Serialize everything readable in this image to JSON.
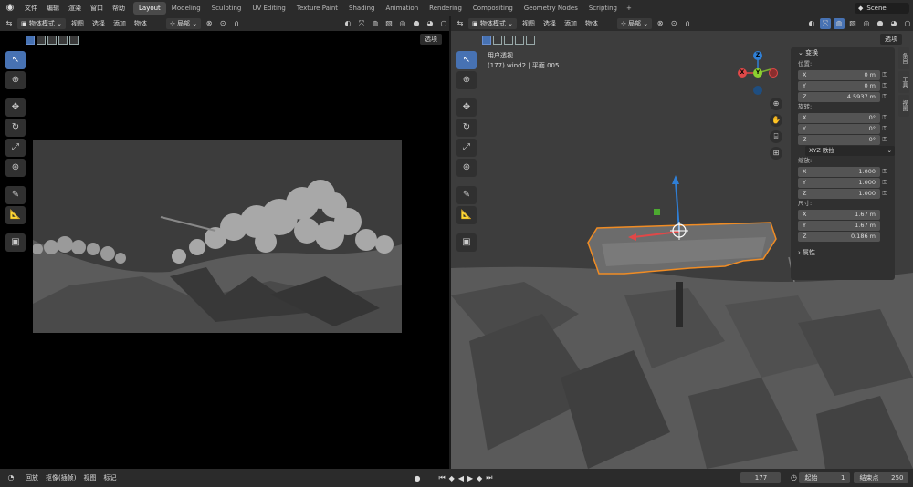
{
  "topbar": {
    "menu": [
      "文件",
      "编辑",
      "渲染",
      "窗口",
      "帮助"
    ],
    "workspaces": [
      "Layout",
      "Modeling",
      "Sculpting",
      "UV Editing",
      "Texture Paint",
      "Shading",
      "Animation",
      "Rendering",
      "Compositing",
      "Geometry Nodes",
      "Scripting"
    ],
    "active_workspace": "Layout",
    "add": "+",
    "scene": "Scene"
  },
  "left_view": {
    "mode": "物体模式",
    "menus": [
      "视图",
      "选择",
      "添加",
      "物体"
    ],
    "transform_space": "局部",
    "options": "选项"
  },
  "right_view": {
    "mode": "物体模式",
    "menus": [
      "视图",
      "选择",
      "添加",
      "物体"
    ],
    "transform_space": "局部",
    "options": "选项",
    "view_name": "用户透视",
    "object_info": "(177) wind2 | 平面.005"
  },
  "gizmo": {
    "x": "X",
    "y": "Y",
    "z": "Z"
  },
  "npanel": {
    "section": "变换",
    "location_label": "位置:",
    "location": [
      {
        "axis": "X",
        "value": "0 m"
      },
      {
        "axis": "Y",
        "value": "0 m"
      },
      {
        "axis": "Z",
        "value": "4.5937 m"
      }
    ],
    "rotation_label": "旋转:",
    "rotation": [
      {
        "axis": "X",
        "value": "0°"
      },
      {
        "axis": "Y",
        "value": "0°"
      },
      {
        "axis": "Z",
        "value": "0°"
      }
    ],
    "rotation_mode": "XYZ 欧拉",
    "scale_label": "缩放:",
    "scale": [
      {
        "axis": "X",
        "value": "1.000"
      },
      {
        "axis": "Y",
        "value": "1.000"
      },
      {
        "axis": "Z",
        "value": "1.000"
      }
    ],
    "dimensions_label": "尺寸:",
    "dimensions": [
      {
        "axis": "X",
        "value": "1.67 m"
      },
      {
        "axis": "Y",
        "value": "1.67 m"
      },
      {
        "axis": "Z",
        "value": "0.186 m"
      }
    ],
    "properties": "属性",
    "tabs": [
      "条目",
      "工具",
      "视图"
    ]
  },
  "timeline": {
    "menus": [
      "回放",
      "抠像(插帧)",
      "视图",
      "标记"
    ],
    "current_frame": "177",
    "start_label": "起始",
    "start": "1",
    "end_label": "结束点",
    "end": "250"
  }
}
